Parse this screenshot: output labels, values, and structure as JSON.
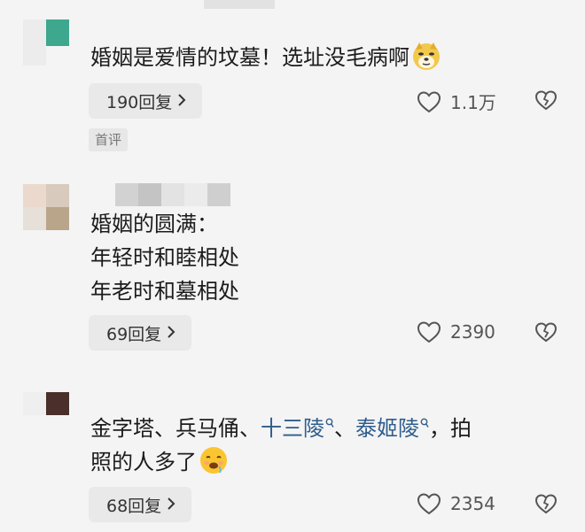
{
  "comments": [
    {
      "text": "婚姻是爱情的坟墓！选址没毛病啊",
      "emoji": "doge-emoji",
      "reply_label": "190回复",
      "badge": "首评",
      "likes": "1.1万"
    },
    {
      "lines": [
        "婚姻的圆满：",
        "年轻时和睦相处",
        "年老时和墓相处"
      ],
      "reply_label": "69回复",
      "likes": "2390"
    },
    {
      "text_a": "金字塔、兵马俑、",
      "tag1": "十三陵",
      "text_b": "、",
      "tag2": "泰姬陵",
      "text_c": "，拍",
      "line2": "照的人多了",
      "emoji": "drooling-face-emoji",
      "reply_label": "68回复",
      "likes": "2354"
    }
  ],
  "icons": {
    "like": "heart-outline-icon",
    "dislike": "broken-heart-icon",
    "chevron": "chevron-right-icon",
    "search": "search-icon"
  },
  "colors": {
    "background": "#f4f4f4",
    "hashtag": "#2f5d8c",
    "button": "#e9e9e9"
  }
}
